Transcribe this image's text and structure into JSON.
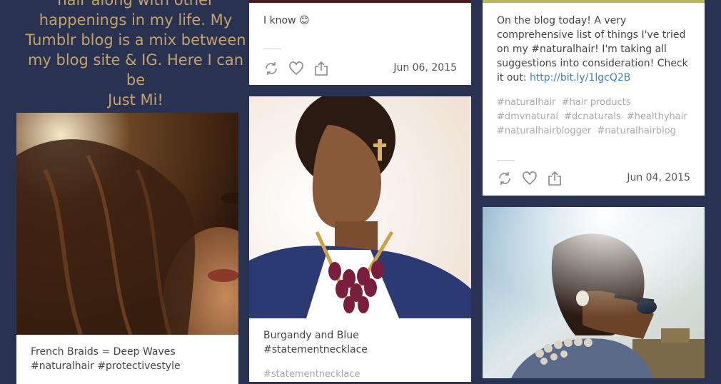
{
  "intro": {
    "line1": "hair along with other",
    "line2": "happenings in my life. My",
    "line3": "Tumblr blog is a mix between",
    "line4": "my blog site & IG. Here I can be",
    "line5": "Just Mi!"
  },
  "posts": {
    "know": {
      "text": "I know 😊",
      "date": "Jun 06, 2015"
    },
    "braids": {
      "caption": "French Braids = Deep Waves #naturalhair #protectivestyle"
    },
    "burgandy": {
      "caption_line1": "Burgandy and Blue",
      "caption_line2": "#statementnecklace",
      "tag": "#statementnecklace"
    },
    "blog": {
      "text": "On the blog today! A very comprehensive list of things I've tried on my #naturalhair! I'm taking all suggestions into consideration! Check it out: ",
      "link": "http://bit.ly/1lgcQ2B",
      "tags": [
        "#naturalhair",
        "#hair products",
        "#dmvnatural",
        "#dcnaturals",
        "#healthyhair",
        "#naturalhairblogger",
        "#naturalhairblog"
      ],
      "date": "Jun 04, 2015"
    }
  },
  "icons": [
    "reblog-icon",
    "heart-icon",
    "share-icon"
  ],
  "colors": {
    "background": "#2a3252",
    "intro_text": "#c4a269",
    "link": "#3a83b8"
  }
}
